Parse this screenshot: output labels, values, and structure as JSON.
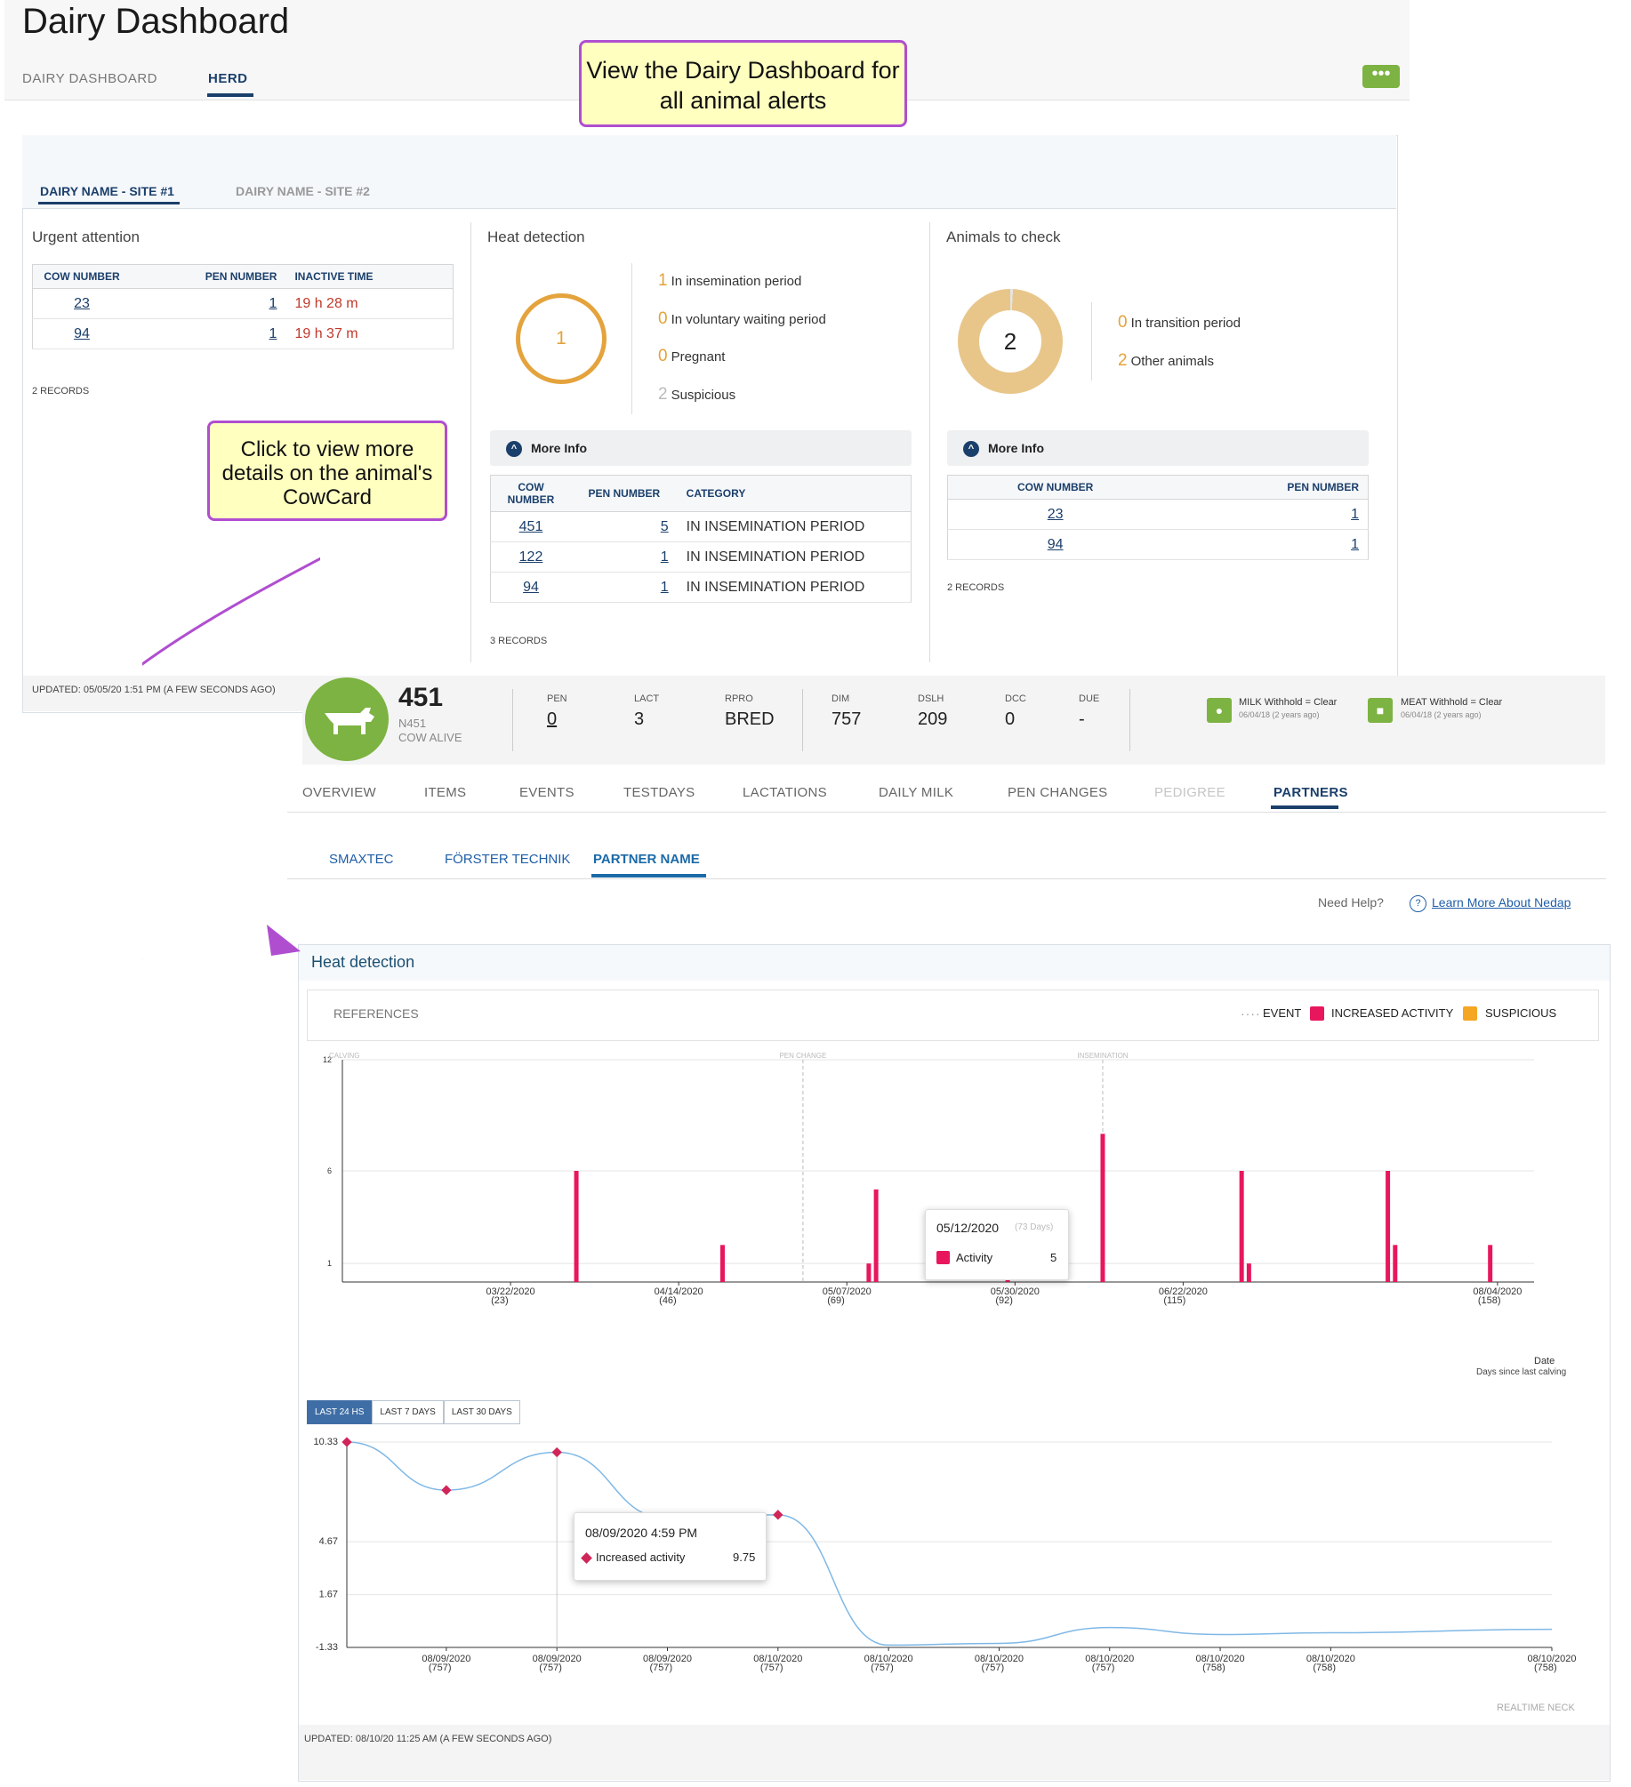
{
  "header": {
    "title": "Dairy Dashboard",
    "tabs": [
      "DAIRY DASHBOARD",
      "HERD"
    ],
    "more_label": "•••"
  },
  "callouts": {
    "dashboard": "View the Dairy Dashboard for all animal alerts",
    "cowcard": "Click to view more details on the animal's CowCard"
  },
  "sites": [
    "DAIRY NAME - SITE #1",
    "DAIRY NAME - SITE #2"
  ],
  "urgent": {
    "title": "Urgent attention",
    "columns": [
      "COW NUMBER",
      "PEN NUMBER",
      "INACTIVE TIME"
    ],
    "rows": [
      {
        "cow": "23",
        "pen": "1",
        "time": "19 h 28 m"
      },
      {
        "cow": "94",
        "pen": "1",
        "time": "19 h 37 m"
      }
    ],
    "records": "2 RECORDS",
    "updated": "UPDATED: 05/05/20 1:51 PM (A FEW SECONDS AGO)"
  },
  "heat": {
    "title": "Heat detection",
    "ring_value": "1",
    "legend": [
      {
        "num": "1",
        "label": "In insemination period"
      },
      {
        "num": "0",
        "label": "In voluntary waiting period"
      },
      {
        "num": "0",
        "label": "Pregnant"
      },
      {
        "num": "2",
        "label": "Suspicious"
      }
    ],
    "more_info": "More Info",
    "columns": [
      "COW NUMBER",
      "PEN NUMBER",
      "CATEGORY"
    ],
    "rows": [
      {
        "cow": "451",
        "pen": "5",
        "category": "IN INSEMINATION PERIOD"
      },
      {
        "cow": "122",
        "pen": "1",
        "category": "IN INSEMINATION PERIOD"
      },
      {
        "cow": "94",
        "pen": "1",
        "category": "IN INSEMINATION PERIOD"
      }
    ],
    "records": "3 RECORDS"
  },
  "check": {
    "title": "Animals to check",
    "ring_value": "2",
    "legend": [
      {
        "num": "0",
        "label": "In transition period"
      },
      {
        "num": "2",
        "label": "Other animals"
      }
    ],
    "more_info": "More Info",
    "columns": [
      "COW NUMBER",
      "PEN NUMBER"
    ],
    "rows": [
      {
        "cow": "23",
        "pen": "1"
      },
      {
        "cow": "94",
        "pen": "1"
      }
    ],
    "records": "2 RECORDS"
  },
  "cowcard": {
    "number": "451",
    "sub1": "N451",
    "sub2": "COW ALIVE",
    "stats": [
      {
        "label": "PEN",
        "value": "0"
      },
      {
        "label": "LACT",
        "value": "3"
      },
      {
        "label": "RPRO",
        "value": "BRED"
      },
      {
        "label": "DIM",
        "value": "757"
      },
      {
        "label": "DSLH",
        "value": "209"
      },
      {
        "label": "DCC",
        "value": "0"
      },
      {
        "label": "DUE",
        "value": "-"
      }
    ],
    "milk": {
      "label": "MILK Withhold = Clear",
      "sub": "06/04/18 (2 years ago)"
    },
    "meat": {
      "label": "MEAT Withhold = Clear",
      "sub": "06/04/18 (2 years ago)"
    },
    "nav": [
      "OVERVIEW",
      "ITEMS",
      "EVENTS",
      "TESTDAYS",
      "LACTATIONS",
      "DAILY MILK",
      "PEN CHANGES",
      "PEDIGREE",
      "PARTNERS"
    ],
    "partners": [
      "SMAXTEC",
      "FÖRSTER TECHNIK",
      "PARTNER NAME"
    ],
    "help": "Need Help?",
    "learn": "Learn More About Nedap"
  },
  "graph": {
    "title": "Heat detection",
    "references": "REFERENCES",
    "legend": [
      "EVENT",
      "INCREASED ACTIVITY",
      "SUSPICIOUS"
    ],
    "colors": {
      "activity": "#e8175d",
      "suspicious": "#f5a623",
      "line": "#7fb8e6"
    },
    "tooltip1": {
      "date": "05/12/2020",
      "days": "(73 Days)",
      "label": "Activity",
      "value": "5"
    },
    "axis_title": "Date",
    "axis_subtitle": "Days since last calving",
    "ranges": [
      "LAST 24 HS",
      "LAST 7 DAYS",
      "LAST 30 DAYS"
    ],
    "tooltip2": {
      "date": "08/09/2020 4:59 PM",
      "label": "Increased activity",
      "value": "9.75"
    },
    "footer_right": "REALTIME NECK",
    "updated": "UPDATED: 08/10/20 11:25 AM (A FEW SECONDS AGO)"
  },
  "chart_data": [
    {
      "type": "bar",
      "title": "Heat detection",
      "ylim": [
        0,
        12
      ],
      "yticks": [
        "12",
        "6",
        "1"
      ],
      "xlim": [
        0,
        163
      ],
      "xticks": [
        {
          "date": "03/22/2020",
          "days": "(23)",
          "d": 23
        },
        {
          "date": "04/14/2020",
          "days": "(46)",
          "d": 46
        },
        {
          "date": "05/07/2020",
          "days": "(69)",
          "d": 69
        },
        {
          "date": "05/30/2020",
          "days": "(92)",
          "d": 92
        },
        {
          "date": "06/22/2020",
          "days": "(115)",
          "d": 115
        },
        {
          "date": "08/04/2020",
          "days": "(158)",
          "d": 158
        }
      ],
      "references": [
        {
          "label": "CALVING",
          "d": 0
        },
        {
          "label": "PEN CHANGE",
          "d": 63
        },
        {
          "label": "INSEMINATION",
          "d": 104
        }
      ],
      "bars": [
        {
          "d": 32,
          "v": 6
        },
        {
          "d": 52,
          "v": 2
        },
        {
          "d": 72,
          "v": 1
        },
        {
          "d": 73,
          "v": 5
        },
        {
          "d": 91,
          "v": 1
        },
        {
          "d": 104,
          "v": 8
        },
        {
          "d": 123,
          "v": 6
        },
        {
          "d": 124,
          "v": 1
        },
        {
          "d": 143,
          "v": 6
        },
        {
          "d": 144,
          "v": 2
        },
        {
          "d": 157,
          "v": 2
        }
      ]
    },
    {
      "type": "line",
      "series_name": "Increased activity",
      "yticks": [
        "10.33",
        "4.67",
        "1.67",
        "-1.33"
      ],
      "ylim": [
        -1.33,
        10.33
      ],
      "xticks": [
        {
          "date": "08/09/2020",
          "days": "(757)"
        },
        {
          "date": "08/09/2020",
          "days": "(757)"
        },
        {
          "date": "08/09/2020",
          "days": "(757)"
        },
        {
          "date": "08/10/2020",
          "days": "(757)"
        },
        {
          "date": "08/10/2020",
          "days": "(757)"
        },
        {
          "date": "08/10/2020",
          "days": "(757)"
        },
        {
          "date": "08/10/2020",
          "days": "(757)"
        },
        {
          "date": "08/10/2020",
          "days": "(758)"
        },
        {
          "date": "08/10/2020",
          "days": "(758)"
        },
        {
          "date": "08/10/2020",
          "days": "(758)"
        }
      ],
      "x": [
        0,
        0.9,
        1.9,
        2.9,
        3.9,
        4.9,
        5.9,
        6.9,
        7.9,
        8.9,
        10.9
      ],
      "values": [
        10.33,
        7.6,
        9.75,
        6.0,
        6.2,
        -1.2,
        -1.1,
        -0.2,
        -0.6,
        -0.5,
        -0.3
      ],
      "marked": [
        true,
        true,
        true,
        true,
        true,
        false,
        false,
        false,
        false,
        false,
        false
      ]
    }
  ]
}
